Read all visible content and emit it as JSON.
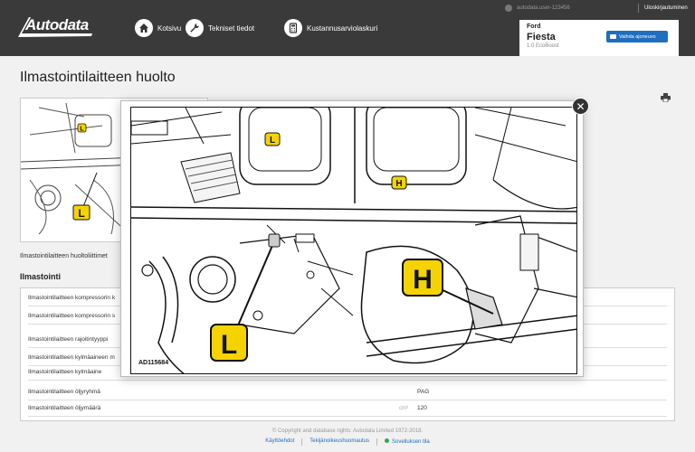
{
  "header": {
    "brand": "Autodata",
    "nav": [
      {
        "label": "Kotsivu",
        "icon": "home-icon"
      },
      {
        "label": "Tekniset tiedot",
        "icon": "wrench-icon"
      },
      {
        "label": "Kustannusarviolaskuri",
        "icon": "calculator-icon"
      }
    ],
    "user": "autodata.user-123456",
    "logout": "Uloskirjautuminen"
  },
  "vehicle": {
    "make": "Ford",
    "model": "Fiesta",
    "engine": "1.0 EcoBoost",
    "change_label": "Vaihda ajoneuvo"
  },
  "page": {
    "title": "Ilmastointilaitteen huolto",
    "thumb_caption": "Ilmastointilaitteen huoltoliittimet",
    "section_title": "Ilmastointi",
    "rows": [
      {
        "label": "Ilmastointilaitteen kompressorin k",
        "unit": "",
        "value": ""
      },
      {
        "label": "Ilmastointilaitteen kompressorin s",
        "unit": "",
        "value": ""
      },
      {
        "label": "Ilmastointilaitteen rajoitintyyppi",
        "unit": "",
        "value": ""
      },
      {
        "label": "Ilmastointilaitteen kylmäaineen m",
        "unit": "",
        "value": ""
      },
      {
        "label": "Ilmastointilaitteen kylmäaine",
        "unit": "",
        "value": ""
      },
      {
        "label": "Ilmastointilaitteen öljyryhmä",
        "unit": "",
        "value": "PAG"
      },
      {
        "label": "Ilmastointilaitteen öljymäärä",
        "unit": "cm³",
        "value": "120"
      }
    ]
  },
  "modal": {
    "image_code": "AD115684",
    "label_low": "L",
    "label_high": "H"
  },
  "footer": {
    "copyright": "© Copyright and database rights: Autodata Limited 1972-2018.",
    "links": [
      "Käyttöehdot",
      "Tekijänoikeushuomautus"
    ],
    "status": "Sovelluksen tila"
  },
  "colors": {
    "header": "#3a3a3a",
    "accent": "#1f6ebf",
    "badge": "#f5d300",
    "status": "#2fa84f"
  }
}
